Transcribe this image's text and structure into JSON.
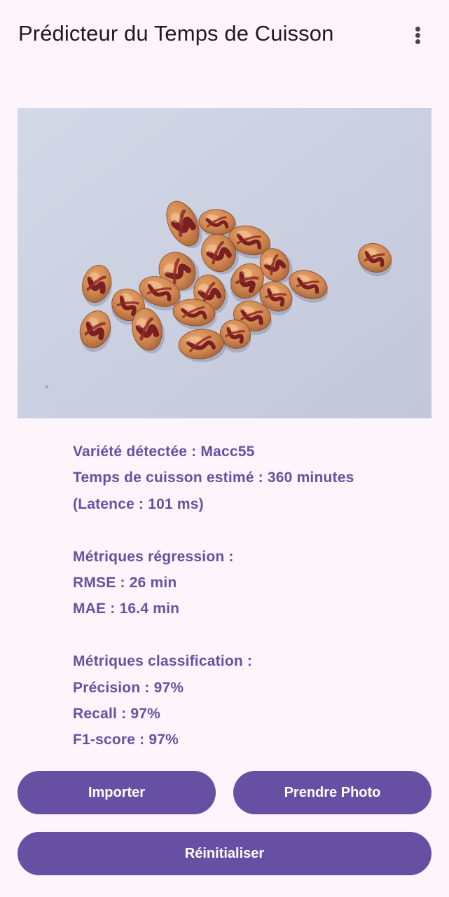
{
  "app_bar": {
    "title": "Prédicteur du Temps de Cuisson",
    "menu_icon": "more-vert-icon"
  },
  "photo": {
    "background": "#c9cfe0",
    "description_icon": "bean-photo"
  },
  "results": {
    "variety": "Variété détectée : Macc55",
    "cooking_time": "Temps de cuisson estimé : 360 minutes",
    "latency": "(Latence : 101 ms)",
    "regression_header": "Métriques régression :",
    "rmse": "RMSE : 26 min",
    "mae": "MAE : 16.4 min",
    "classification_header": "Métriques classification :",
    "precision": "Précision : 97%",
    "recall": "Recall : 97%",
    "f1": "F1-score : 97%"
  },
  "buttons": {
    "import_label": "Importer",
    "take_photo_label": "Prendre Photo",
    "reset_label": "Réinitialiser"
  },
  "colors": {
    "accent": "#6750a4",
    "background": "#fdf5fb",
    "title_text": "#1d1b20"
  }
}
